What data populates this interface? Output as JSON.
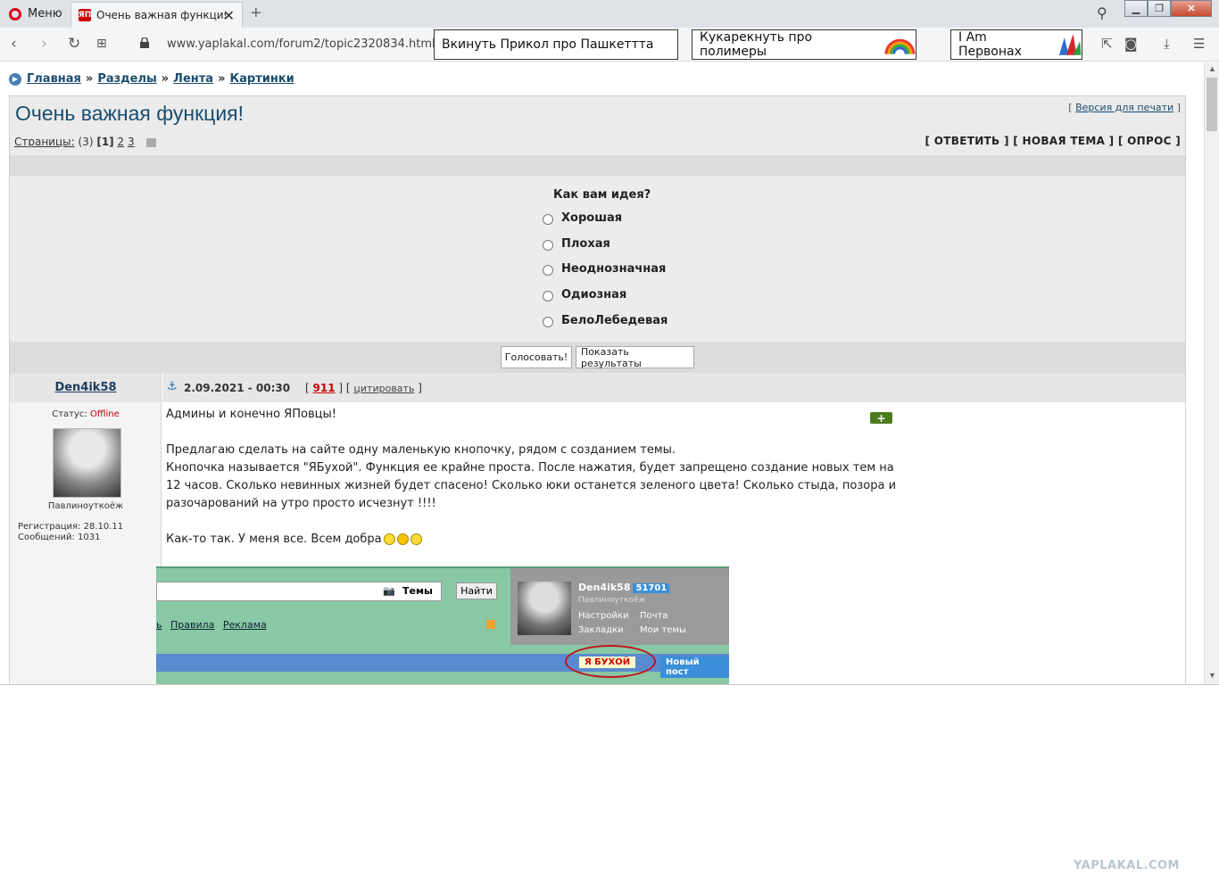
{
  "browser": {
    "menu_label": "Меню",
    "tab_title": "Очень важная функция! -",
    "url": "www.yaplakal.com/forum2/topic2320834.html",
    "ads": [
      "Вкинуть Прикол про Пашкеттта",
      "Кукарекнуть про полимеры",
      "I Am Первонах"
    ]
  },
  "breadcrumb": [
    "Главная",
    "Разделы",
    "Лента",
    "Картинки"
  ],
  "breadcrumb_sep": "»",
  "topic": {
    "title": "Очень важная функция!",
    "print_open": "[",
    "print_link": "Версия для печати",
    "print_close": "]",
    "pages_label": "Страницы:",
    "pages_count": "(3)",
    "current_page": "[1]",
    "page_2": "2",
    "page_3": "3",
    "actions": "[ ОТВЕТИТЬ ] [ НОВАЯ ТЕМА ] [ ОПРОС ]"
  },
  "poll": {
    "question": "Как вам идея?",
    "options": [
      "Хорошая",
      "Плохая",
      "Неоднозначная",
      "Одиозная",
      "БелоЛебедевая"
    ],
    "vote_button": "Голосовать!",
    "results_button": "Показать результаты"
  },
  "post": {
    "username": "Den4ik58",
    "date": "2.09.2021 - 00:30",
    "rating_open": "[",
    "rating": "911",
    "rating_mid": "] [",
    "quote": "цитировать",
    "rating_close": "]",
    "status_label": "Статус:",
    "status_value": "Offline",
    "user_title": "Павлиноуткоёж",
    "registration": "Регистрация: 28.10.11",
    "messages": "Сообщений: 1031",
    "body": {
      "line1": "Админы и конечно ЯПовцы!",
      "line2": "Предлагаю сделать на сайте одну маленькую кнопочку, рядом с созданием темы.",
      "line3": "Кнопочка называется \"ЯБухой\". Функция ее крайне проста. После нажатия, будет запрещено создание новых тем на",
      "line4": "12 часов. Сколько невинных жизней будет спасено! Сколько юки останется зеленого цвета! Сколько стыда, позора и",
      "line5": "разочарований на утро просто исчезнут !!!!",
      "line6": "Как-то так. У меня все. Всем добра"
    }
  },
  "embed": {
    "themes": "Темы",
    "find": "Найти",
    "link_prefix": "ь",
    "link_rules": "Правила",
    "link_ads": "Реклама",
    "user": "Den4ik58",
    "count": "51701",
    "subtitle": "Павлиноуткоёж",
    "menu_settings": "Настройки",
    "menu_mail": "Почта",
    "menu_bookmarks": "Закладки",
    "menu_topics": "Мои темы",
    "ybuhoy": "Я БУХОЙ",
    "newpost": "Новый пост"
  },
  "watermark": "YAPLAKAL.COM",
  "colors": {
    "link": "#1b4d6e",
    "offline": "#bb0000",
    "rating": "#cc0000",
    "accent_green": "#4d7c1f"
  }
}
